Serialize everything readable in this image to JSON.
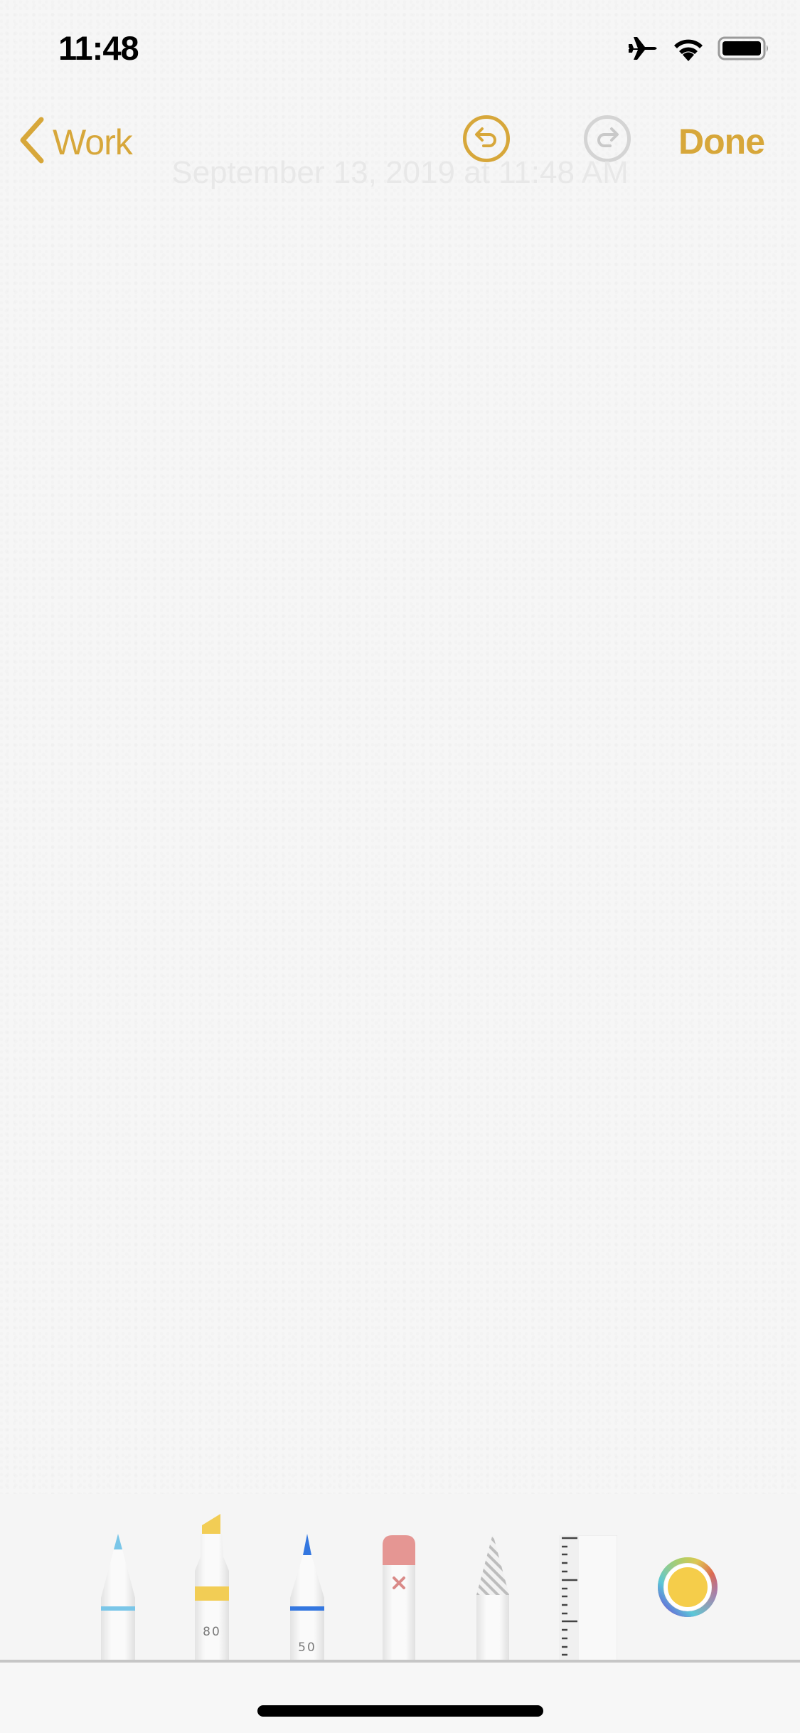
{
  "status_bar": {
    "time": "11:48",
    "icons": [
      "airplane-mode-icon",
      "wifi-icon",
      "battery-icon"
    ]
  },
  "nav": {
    "back_label": "Work",
    "back_icon": "chevron-left-icon",
    "undo_icon": "undo-icon",
    "redo_icon": "redo-icon",
    "undo_enabled": true,
    "redo_enabled": false,
    "done_label": "Done"
  },
  "note": {
    "date": "September 13, 2019 at 11:48 AM"
  },
  "tool_palette": {
    "tools": [
      {
        "name": "pen",
        "color": "#7ac6e8",
        "selected": false
      },
      {
        "name": "marker",
        "color": "#f2cd55",
        "opacity_label": "80",
        "selected": false
      },
      {
        "name": "pencil",
        "color": "#3477e0",
        "opacity_label": "50",
        "selected": false
      },
      {
        "name": "eraser",
        "color": "#e59693",
        "selected": false
      },
      {
        "name": "lasso",
        "selected": false
      },
      {
        "name": "ruler",
        "selected": false
      }
    ],
    "current_color": "#f5cd4a"
  },
  "colors": {
    "accent": "#d7a73a",
    "disabled": "#d4d4d4"
  }
}
